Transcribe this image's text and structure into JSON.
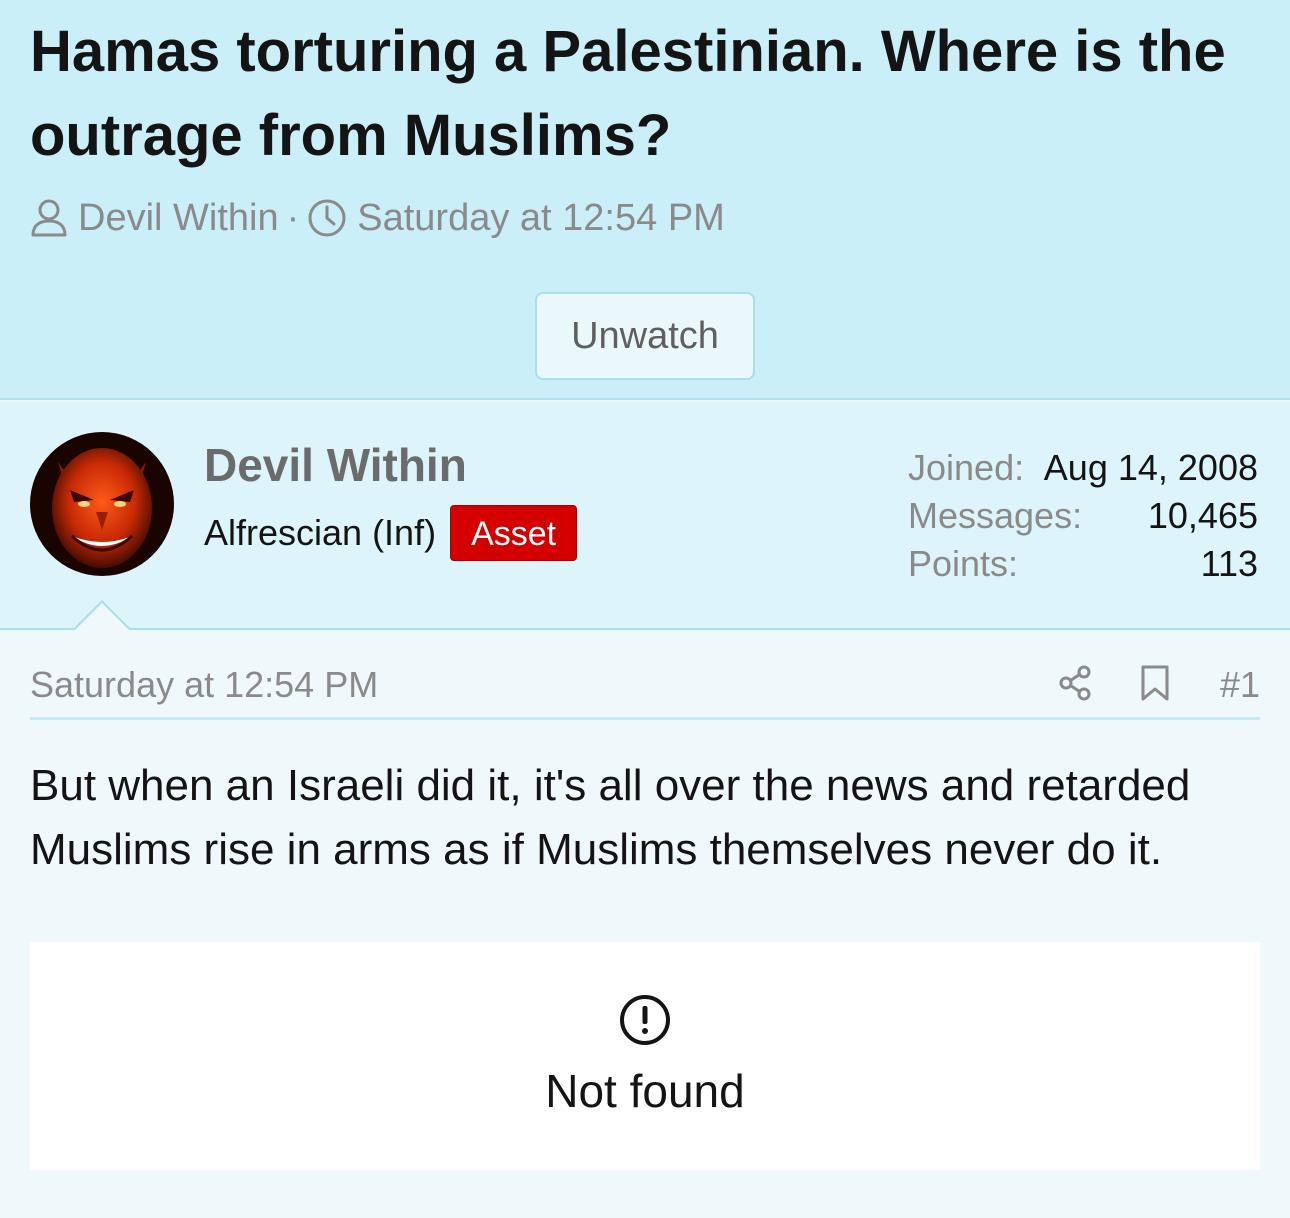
{
  "thread": {
    "title": "Hamas torturing a Palestinian. Where is the outrage from Muslims?",
    "author": "Devil Within",
    "separator": "·",
    "date": "Saturday at 12:54 PM",
    "unwatch_label": "Unwatch"
  },
  "user": {
    "name": "Devil Within",
    "title": "Alfrescian (Inf)",
    "badge": "Asset",
    "badge_color": "#d40000",
    "stats": [
      {
        "label": "Joined:",
        "value": "Aug 14, 2008"
      },
      {
        "label": "Messages:",
        "value": "10,465"
      },
      {
        "label": "Points:",
        "value": "113"
      }
    ]
  },
  "post": {
    "date": "Saturday at 12:54 PM",
    "number": "#1",
    "body": "But when an Israeli did it, it's all over the news and retarded Muslims rise in arms as if Muslims themselves never do it.",
    "embed": {
      "icon": "alert-circle-icon",
      "text": "Not found"
    }
  },
  "colors": {
    "header_bg": "#cbeff8",
    "user_bg": "#ddf4fa",
    "post_bg": "#eff9fc",
    "border": "#a9dfec"
  }
}
